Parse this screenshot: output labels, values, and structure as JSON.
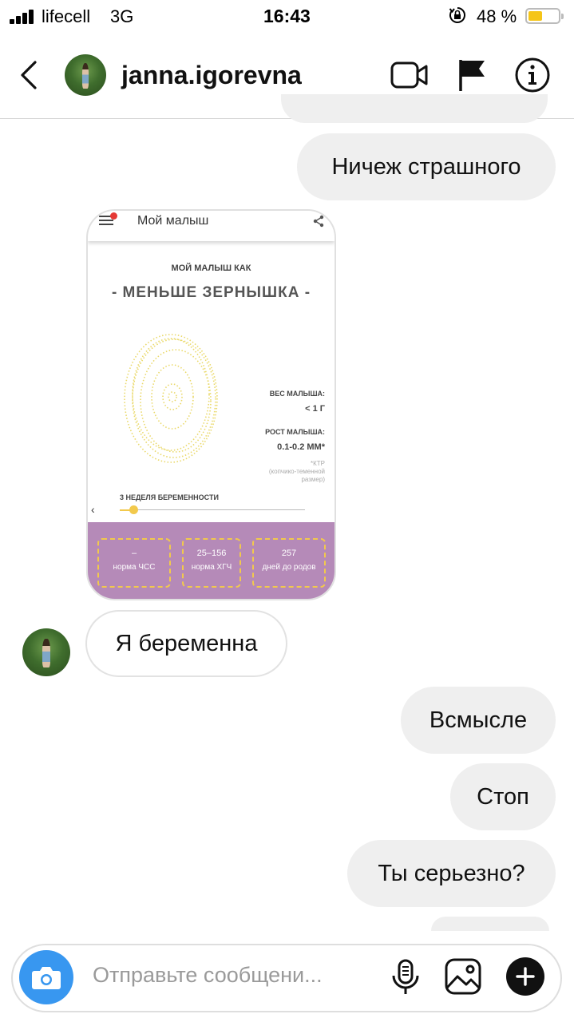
{
  "status_bar": {
    "carrier": "lifecell",
    "network": "3G",
    "time": "16:43",
    "battery_percent": "48 %",
    "battery_level": 0.48,
    "battery_color": "#f5c518",
    "icons": [
      "signal-icon",
      "orientation-lock-icon",
      "battery-icon"
    ]
  },
  "header": {
    "username": "janna.igorevna",
    "icons": [
      "back-chevron-icon",
      "avatar",
      "video-call-icon",
      "flag-icon",
      "info-icon"
    ]
  },
  "messages": [
    {
      "sender": "me",
      "text": "Ничеж страшного"
    },
    {
      "sender": "them",
      "type": "shared-image"
    },
    {
      "sender": "them",
      "text": "Я беременна"
    },
    {
      "sender": "me",
      "text": "Всмысле"
    },
    {
      "sender": "me",
      "text": "Стоп"
    },
    {
      "sender": "me",
      "text": "Ты серьезно?"
    }
  ],
  "shared_card": {
    "app_title": "Мой малыш",
    "label_top": "МОЙ МАЛЫШ КАК",
    "label_main": "- МЕНЬШЕ ЗЕРНЫШКА -",
    "weight_label": "ВЕС МАЛЫША:",
    "weight_value": "< 1 Г",
    "height_label": "РОСТ МАЛЫША:",
    "height_value": "0.1-0.2 ММ*",
    "footnote_1": "*КТР",
    "footnote_2": "(копчико-теменной",
    "footnote_3": "размер)",
    "week_label": "3 НЕДЕЛЯ БЕРЕМЕННОСТИ",
    "stats": [
      {
        "value": "–",
        "label": "норма ЧСС"
      },
      {
        "value": "25–156",
        "label": "норма ХГЧ"
      },
      {
        "value": "257",
        "label": "дней до родов"
      }
    ],
    "colors": {
      "panel": "#b58ab8",
      "accent": "#f2c94c"
    }
  },
  "composer": {
    "placeholder": "Отправьте сообщени...",
    "icons": [
      "camera-icon",
      "microphone-icon",
      "gallery-icon",
      "plus-icon"
    ],
    "camera_color": "#3897f0"
  }
}
